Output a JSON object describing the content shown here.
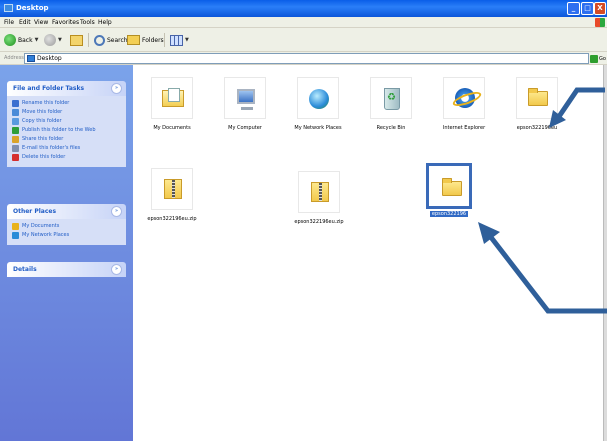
{
  "window": {
    "title": "Desktop",
    "controls": {
      "minimize": "_",
      "maximize": "□",
      "close": "X"
    }
  },
  "menubar": {
    "items": [
      "File",
      "Edit",
      "View",
      "Favorites",
      "Tools",
      "Help"
    ]
  },
  "toolbar": {
    "back_label": "Back",
    "search_label": "Search",
    "folders_label": "Folders"
  },
  "address": {
    "label": "Address",
    "value": "Desktop",
    "go_label": "Go"
  },
  "taskpane": {
    "file_folder_tasks": {
      "title": "File and Folder Tasks",
      "items": [
        {
          "label": "Rename this folder",
          "icon": "rename-icon",
          "color": "#3c6fd0"
        },
        {
          "label": "Move this folder",
          "icon": "move-icon",
          "color": "#4a8ad8"
        },
        {
          "label": "Copy this folder",
          "icon": "copy-icon",
          "color": "#5a9ae0"
        },
        {
          "label": "Publish this folder to the Web",
          "icon": "publish-icon",
          "color": "#2e9e3a"
        },
        {
          "label": "Share this folder",
          "icon": "share-icon",
          "color": "#d9a32a"
        },
        {
          "label": "E-mail this folder's files",
          "icon": "email-icon",
          "color": "#7f8fb0"
        },
        {
          "label": "Delete this folder",
          "icon": "delete-icon",
          "color": "#d62f2f"
        }
      ]
    },
    "other_places": {
      "title": "Other Places",
      "items": [
        {
          "label": "My Documents",
          "icon": "my-documents-icon",
          "color": "#e8b21c"
        },
        {
          "label": "My Network Places",
          "icon": "network-places-icon",
          "color": "#2a8bd8"
        }
      ]
    },
    "details": {
      "title": "Details"
    },
    "collapse_glyph": "»"
  },
  "files": [
    {
      "label": "My Documents",
      "icon": "my-documents-icon"
    },
    {
      "label": "My Computer",
      "icon": "my-computer-icon"
    },
    {
      "label": "My Network Places",
      "icon": "network-places-icon"
    },
    {
      "label": "Recycle Bin",
      "icon": "recycle-bin-icon"
    },
    {
      "label": "Internet Explorer",
      "icon": "internet-explorer-icon"
    },
    {
      "label": "epson322196eu",
      "icon": "folder-icon"
    },
    {
      "label": "epson322196eu.zip",
      "icon": "zip-icon"
    },
    {
      "label": "epson322196eu.zip",
      "icon": "zip-icon"
    },
    {
      "label": "epson322196",
      "icon": "folder-icon",
      "selected": true
    }
  ],
  "colors": {
    "titlebar": "#0a5ee8",
    "taskpane": "#7ba3ea",
    "selection": "#316ac5",
    "annotation_arrow": "#2f5f9a"
  }
}
